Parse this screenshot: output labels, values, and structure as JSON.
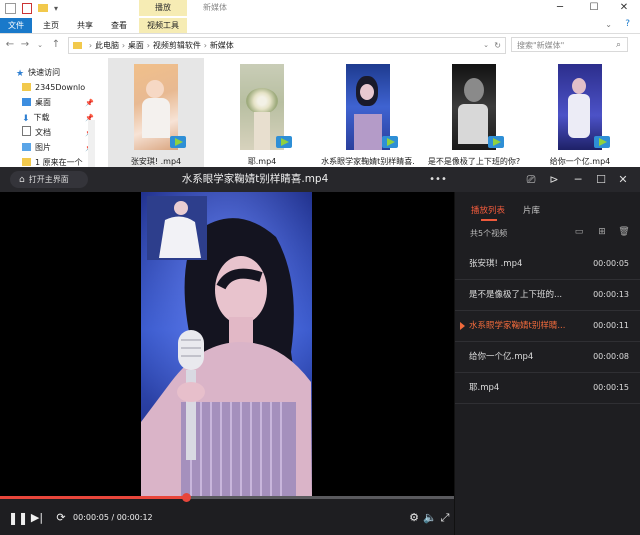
{
  "explorer": {
    "context_tab": "播放",
    "title": "新媒体",
    "window_controls": {
      "minimize": "─",
      "maximize": "☐",
      "close": "✕"
    },
    "ribbon_tabs": [
      "文件",
      "主页",
      "共享",
      "查看",
      "视频工具"
    ],
    "path": [
      "此电脑",
      "桌面",
      "视频剪辑软件",
      "新媒体"
    ],
    "search_placeholder": "搜索\"新媒体\"",
    "sidebar": [
      {
        "label": "快速访问",
        "icon": "star-icon"
      },
      {
        "label": "2345Downlo",
        "icon": "folder-icon"
      },
      {
        "label": "桌面",
        "icon": "desktop-icon"
      },
      {
        "label": "下载",
        "icon": "download-icon"
      },
      {
        "label": "文档",
        "icon": "document-icon"
      },
      {
        "label": "图片",
        "icon": "pictures-icon"
      },
      {
        "label": "1 原来在一个",
        "icon": "folder-icon"
      }
    ],
    "files": [
      {
        "name": "张安琪! .mp4"
      },
      {
        "name": "耶.mp4"
      },
      {
        "name": "水系眼学家鞠婧t别样睛喜."
      },
      {
        "name": "是不是像极了上下班的你?"
      },
      {
        "name": "给你一个亿.mp4"
      }
    ]
  },
  "player": {
    "home_label": "打开主界面",
    "title": "水系眼学家鞠婧t别样睛喜.mp4",
    "time_current": "00:00:05",
    "time_separator": " / ",
    "time_total": "00:00:12",
    "progress": 0.41,
    "accent": "#e8463b",
    "tabs": {
      "list": "播放列表",
      "library": "片库"
    },
    "count_label": "共5个视频",
    "playlist": [
      {
        "name": "张安琪! .mp4",
        "duration": "00:00:05",
        "active": false
      },
      {
        "name": "是不是像极了上下班的...",
        "duration": "00:00:13",
        "active": false
      },
      {
        "name": "水系眼学家鞠婧t别样睛...",
        "duration": "00:00:11",
        "active": true
      },
      {
        "name": "给你一个亿.mp4",
        "duration": "00:00:08",
        "active": false
      },
      {
        "name": "耶.mp4",
        "duration": "00:00:15",
        "active": false
      }
    ]
  }
}
